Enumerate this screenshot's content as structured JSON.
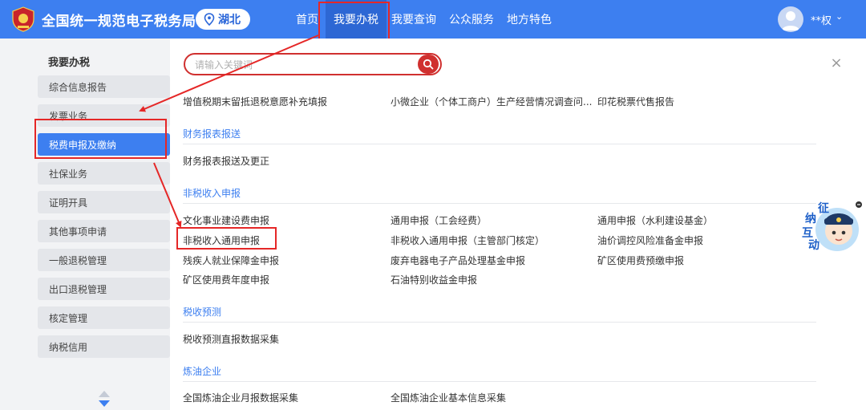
{
  "header": {
    "site_title": "全国统一规范电子税务局",
    "region": "湖北",
    "nav": [
      {
        "label": "首页"
      },
      {
        "label": "我要办税"
      },
      {
        "label": "我要查询"
      },
      {
        "label": "公众服务"
      },
      {
        "label": "地方特色"
      }
    ],
    "user_name": "**权"
  },
  "sidebar": {
    "title": "我要办税",
    "items": [
      {
        "label": "综合信息报告"
      },
      {
        "label": "发票业务"
      },
      {
        "label": "税费申报及缴纳"
      },
      {
        "label": "社保业务"
      },
      {
        "label": "证明开具"
      },
      {
        "label": "其他事项申请"
      },
      {
        "label": "一般退税管理"
      },
      {
        "label": "出口退税管理"
      },
      {
        "label": "核定管理"
      },
      {
        "label": "纳税信用"
      }
    ]
  },
  "search": {
    "placeholder": "请输入关键词"
  },
  "menu": {
    "top_links": [
      "增值税期末留抵退税意愿补充填报",
      "小微企业（个体工商户）生产经营情况调查问...",
      "印花税票代售报告"
    ],
    "sections": [
      {
        "title": "财务报表报送",
        "links": [
          "财务报表报送及更正"
        ]
      },
      {
        "title": "非税收入申报",
        "links": [
          "文化事业建设费申报",
          "通用申报（工会经费）",
          "通用申报（水利建设基金）",
          "非税收入通用申报",
          "非税收入通用申报（主管部门核定）",
          "油价调控风险准备金申报",
          "残疾人就业保障金申报",
          "废弃电器电子产品处理基金申报",
          "矿区使用费预缴申报",
          "矿区使用费年度申报",
          "石油特别收益金申报"
        ]
      },
      {
        "title": "税收预测",
        "links": [
          "税收预测直报数据采集"
        ]
      },
      {
        "title": "炼油企业",
        "links": [
          "全国炼油企业月报数据采集",
          "全国炼油企业基本信息采集"
        ]
      }
    ]
  },
  "widget": {
    "chars": [
      "征",
      "纳",
      "互",
      "动"
    ]
  },
  "colors": {
    "brand_blue": "#3d7ff0",
    "nav_active": "#2d67d4",
    "highlight_red": "#e52727",
    "search_red": "#d0302f"
  }
}
